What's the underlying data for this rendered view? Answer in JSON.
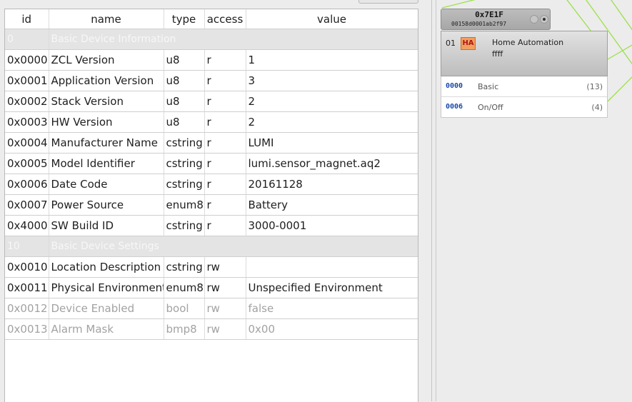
{
  "table": {
    "columns": [
      "id",
      "name",
      "type",
      "access",
      "value"
    ],
    "rows": [
      {
        "kind": "group",
        "id": "0",
        "name": "Basic Device Information"
      },
      {
        "kind": "attr",
        "id": "0x0000",
        "name": "ZCL Version",
        "type": "u8",
        "access": "r",
        "value": "1"
      },
      {
        "kind": "attr",
        "id": "0x0001",
        "name": "Application Version",
        "type": "u8",
        "access": "r",
        "value": "3"
      },
      {
        "kind": "attr",
        "id": "0x0002",
        "name": "Stack Version",
        "type": "u8",
        "access": "r",
        "value": "2"
      },
      {
        "kind": "attr",
        "id": "0x0003",
        "name": "HW Version",
        "type": "u8",
        "access": "r",
        "value": "2"
      },
      {
        "kind": "attr",
        "id": "0x0004",
        "name": "Manufacturer Name",
        "type": "cstring",
        "access": "r",
        "value": "LUMI"
      },
      {
        "kind": "attr",
        "id": "0x0005",
        "name": "Model Identifier",
        "type": "cstring",
        "access": "r",
        "value": "lumi.sensor_magnet.aq2"
      },
      {
        "kind": "attr",
        "id": "0x0006",
        "name": "Date Code",
        "type": "cstring",
        "access": "r",
        "value": "20161128"
      },
      {
        "kind": "attr",
        "id": "0x0007",
        "name": "Power Source",
        "type": "enum8",
        "access": "r",
        "value": "Battery"
      },
      {
        "kind": "attr",
        "id": "0x4000",
        "name": "SW Build ID",
        "type": "cstring",
        "access": "r",
        "value": "3000-0001"
      },
      {
        "kind": "group",
        "id": "10",
        "name": "Basic Device Settings"
      },
      {
        "kind": "attr",
        "id": "0x0010",
        "name": "Location Description",
        "type": "cstring",
        "access": "rw",
        "value": ""
      },
      {
        "kind": "attr",
        "id": "0x0011",
        "name": "Physical Environment",
        "type": "enum8",
        "access": "rw",
        "value": "Unspecified Environment"
      },
      {
        "kind": "attr",
        "disabled": true,
        "id": "0x0012",
        "name": "Device Enabled",
        "type": "bool",
        "access": "rw",
        "value": "false"
      },
      {
        "kind": "attr",
        "disabled": true,
        "id": "0x0013",
        "name": "Alarm Mask",
        "type": "bmp8",
        "access": "rw",
        "value": "0x00"
      }
    ]
  },
  "node": {
    "address": "0x7E1F",
    "mac": "00158d0001ab2f97",
    "endpoint": {
      "number": "01",
      "badge": "HA",
      "profile": "Home Automation",
      "device_id": "ffff"
    },
    "clusters": [
      {
        "id": "0000",
        "name": "Basic",
        "count": "(13)"
      },
      {
        "id": "0006",
        "name": "On/Off",
        "count": "(4)"
      }
    ]
  },
  "colors": {
    "wire": "#9be04a",
    "cluster_id": "#1a4aa8",
    "badge_fill": "#f0a060",
    "badge_text": "#b01818"
  }
}
